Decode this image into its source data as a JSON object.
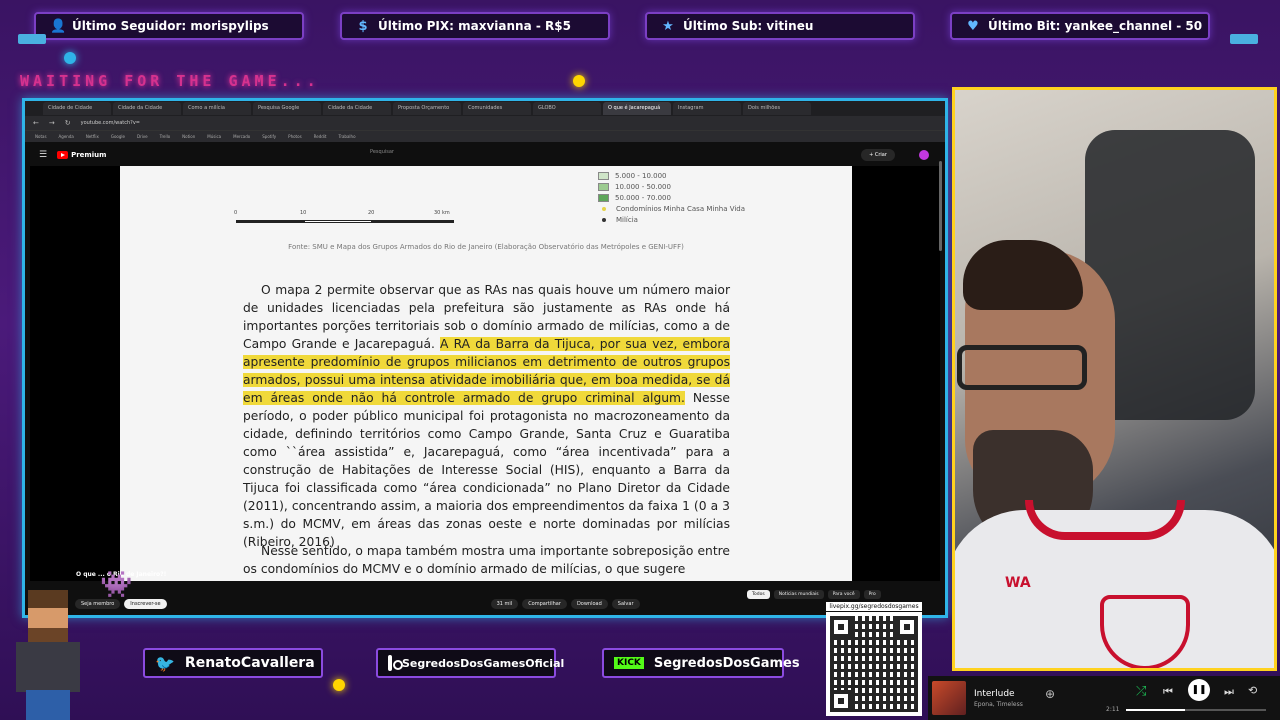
{
  "alerts": {
    "follower": "Último Seguidor: morispylips",
    "pix": "Último PIX: maxvianna - R$5",
    "sub": "Último Sub: vitineu",
    "bit": "Último Bit: yankee_channel - 50"
  },
  "waiting_text": "WAITING FOR THE GAME...",
  "browser": {
    "tabs": [
      "Cidade de Cidade",
      "Cidade da Cidade",
      "Como a milícia",
      "Pesquisa Google",
      "Cidade da Cidade",
      "Proposta Orçamento",
      "Comunidades",
      "GLOBO",
      "O que é Jacarepaguá",
      "Instagram",
      "Dois milhões"
    ],
    "url": "youtube.com/watch?v=",
    "bookmarks": [
      "Notas",
      "Agenda",
      "Netflix",
      "Google",
      "Drive",
      "Trello",
      "Notion",
      "Música",
      "Mercado",
      "Spotify",
      "Photos",
      "Reddit",
      "Trabalho"
    ],
    "yt_premium": "Premium",
    "yt_search_placeholder": "Pesquisar",
    "yt_create": "+ Criar"
  },
  "document": {
    "legend": [
      {
        "label": "5.000 - 10.000",
        "color": "#cfe5c8"
      },
      {
        "label": "10.000 - 50.000",
        "color": "#9ccb90"
      },
      {
        "label": "50.000 - 70.000",
        "color": "#5ea65a"
      }
    ],
    "legend_points": [
      {
        "label": "Condomínios Minha Casa Minha Vida",
        "color": "#e6d44a"
      },
      {
        "label": "Milícia",
        "color": "#333333"
      }
    ],
    "scale_labels": [
      "0",
      "10",
      "20",
      "30 km"
    ],
    "source": "Fonte: SMU e Mapa dos Grupos Armados do Rio de Janeiro (Elaboração Observatório das Metrópoles e GENI-UFF)",
    "p1_before": "O mapa 2 permite observar que as RAs nas quais houve um número maior de unidades licenciadas pela prefeitura são justamente as RAs onde há importantes porções territoriais sob o domínio armado de milícias, como a de Campo Grande e Jacarepaguá. ",
    "p1_highlight": "A RA da Barra da Tijuca, por sua vez, embora apresente predomínio de grupos milicianos em detrimento de outros grupos armados, possui uma intensa atividade imobiliária que, em boa medida, se dá em áreas onde não há controle armado de grupo criminal algum.",
    "p1_after": " Nesse período, o poder público municipal foi protagonista no macrozoneamento da cidade, definindo territórios como Campo Grande, Santa Cruz e Guaratiba como ``área assistida” e, Jacarepaguá, como “área incentivada” para a construção de Habitações de Interesse Social (HIS), enquanto a Barra da Tijuca foi classificada como “área condicionada” no Plano Diretor da Cidade (2011), concentrando assim, a maioria dos empreendimentos da faixa 1 (0 a 3 s.m.) do MCMV, em áreas das zonas oeste e norte dominadas por milícias (Ribeiro, 2016)",
    "p2": "Nesse sentido, o mapa também mostra uma importante sobreposição entre os condomínios do MCMV e o domínio armado de milícias, o que sugere"
  },
  "video": {
    "title": "O que ... o Rio de Janeiro?!",
    "join": "Seja membro",
    "subscribe": "Inscrever-se",
    "likes": "31 mil",
    "share": "Compartilhar",
    "download": "Download",
    "save": "Salvar",
    "chips": [
      "Todos",
      "Notícias mundiais",
      "Para você",
      "Pro"
    ]
  },
  "socials": {
    "twitter": "RenatoCavallera",
    "instagram": "SegredosDosGamesOficial",
    "kick": "SegredosDosGames",
    "kick_badge": "KICK"
  },
  "qr_label": "livepix.gg/segredosdosgames",
  "player": {
    "track": "Interlude",
    "artist": "Epona, Timeless",
    "time": "2:11",
    "progress": 0.42
  },
  "webcam_brand": "WA"
}
